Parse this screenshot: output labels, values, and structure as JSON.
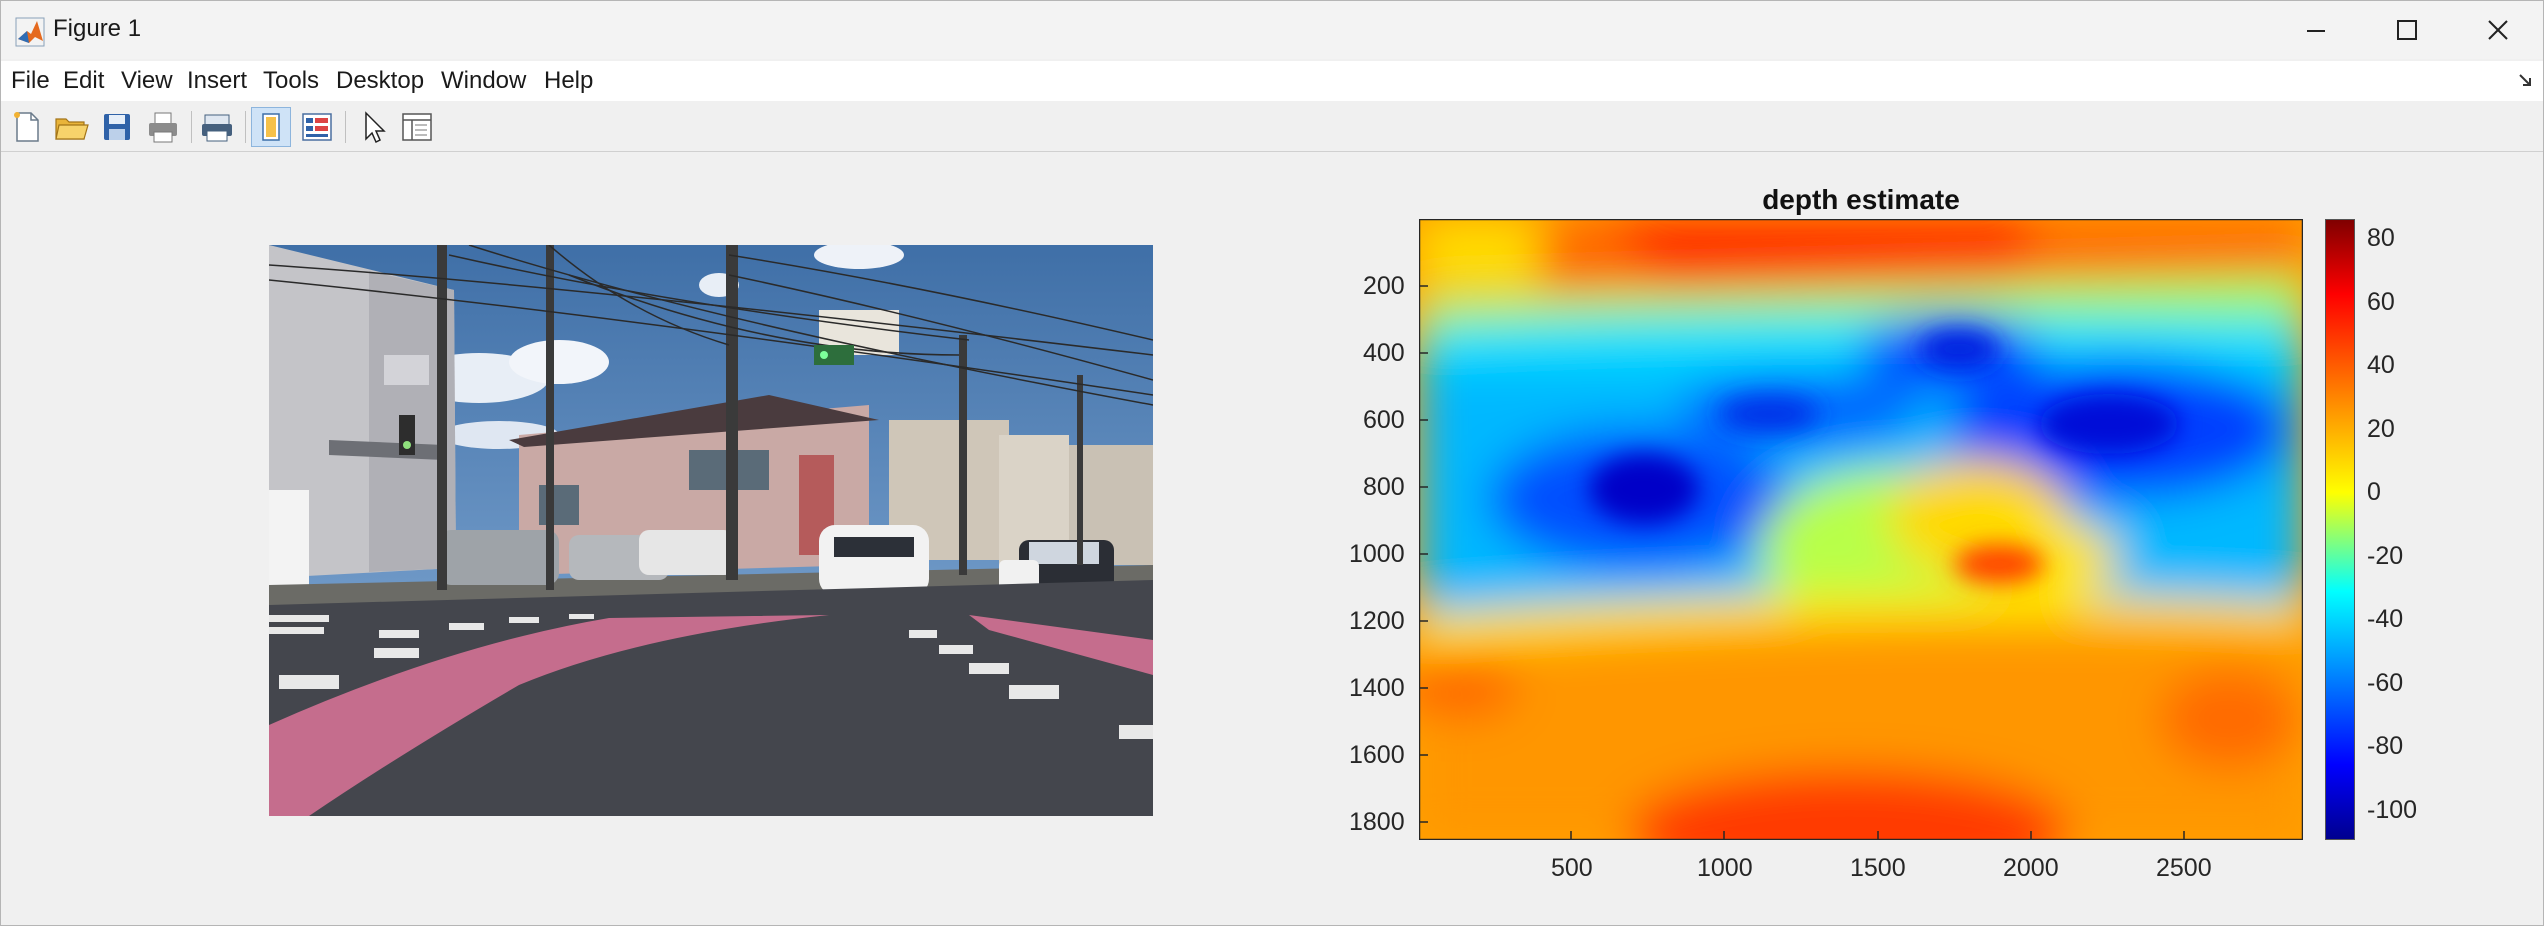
{
  "window": {
    "title": "Figure 1"
  },
  "menubar": {
    "items": [
      "File",
      "Edit",
      "View",
      "Insert",
      "Tools",
      "Desktop",
      "Window",
      "Help"
    ]
  },
  "toolbar": {
    "buttons": [
      "new-figure",
      "open-file",
      "save-figure",
      "print-figure",
      "print-preview",
      "toggle-plot-tools-icon",
      "link-plot",
      "edit-plot",
      "property-inspector"
    ]
  },
  "figure": {
    "photo": {
      "description_hidden": true
    },
    "depth_plot": {
      "title": "depth estimate",
      "x_ticks": [
        "500",
        "1000",
        "1500",
        "2000",
        "2500"
      ],
      "y_ticks": [
        "200",
        "400",
        "600",
        "800",
        "1000",
        "1200",
        "1400",
        "1600",
        "1800"
      ],
      "colorbar_ticks": [
        "80",
        "60",
        "40",
        "20",
        "0",
        "-20",
        "-40",
        "-60",
        "-80",
        "-100"
      ]
    }
  },
  "chart_data": {
    "type": "heatmap",
    "title": "depth estimate",
    "x_ticks": [
      500,
      1000,
      1500,
      2000,
      2500
    ],
    "y_ticks": [
      200,
      400,
      600,
      800,
      1000,
      1200,
      1400,
      1600,
      1800
    ],
    "xlim": [
      0,
      2880
    ],
    "ylim": [
      0,
      1850
    ],
    "y_direction": "reverse",
    "colormap": "jet",
    "clim": [
      -110,
      85
    ],
    "colorbar_ticks": [
      80,
      60,
      40,
      20,
      0,
      -20,
      -40,
      -60,
      -80,
      -100
    ]
  }
}
